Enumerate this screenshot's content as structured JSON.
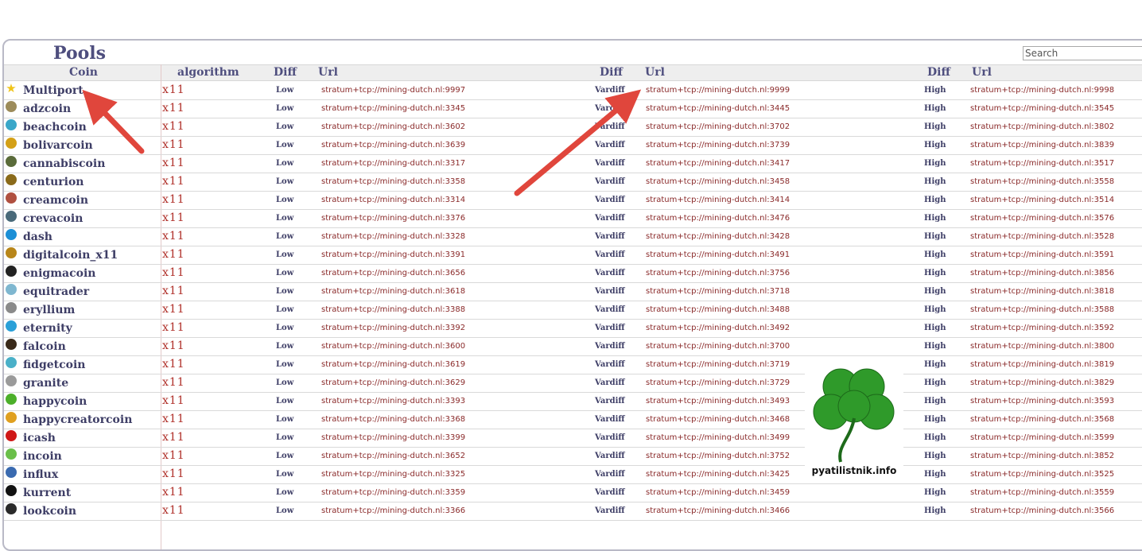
{
  "page": {
    "title": "Pools",
    "search_placeholder": "Search"
  },
  "headers": {
    "coin": "Coin",
    "algorithm": "algorithm",
    "diff1": "Diff",
    "url1": "Url",
    "diff2": "Diff",
    "url2": "Url",
    "diff3": "Diff",
    "url3": "Url"
  },
  "rows": [
    {
      "coin": "Multiport",
      "icon": "star-icon",
      "icon_color": "#f0c419",
      "algo": "x11",
      "d1": "Low",
      "u1": "stratum+tcp://mining-dutch.nl:9997",
      "d2": "Vardiff",
      "u2": "stratum+tcp://mining-dutch.nl:9999",
      "d3": "High",
      "u3": "stratum+tcp://mining-dutch.nl:9998"
    },
    {
      "coin": "adzcoin",
      "icon": "coin-icon",
      "icon_color": "#9c8b5a",
      "algo": "x11",
      "d1": "Low",
      "u1": "stratum+tcp://mining-dutch.nl:3345",
      "d2": "Vardiff",
      "u2": "stratum+tcp://mining-dutch.nl:3445",
      "d3": "High",
      "u3": "stratum+tcp://mining-dutch.nl:3545"
    },
    {
      "coin": "beachcoin",
      "icon": "coin-icon",
      "icon_color": "#3aa7c9",
      "algo": "x11",
      "d1": "Low",
      "u1": "stratum+tcp://mining-dutch.nl:3602",
      "d2": "Vardiff",
      "u2": "stratum+tcp://mining-dutch.nl:3702",
      "d3": "High",
      "u3": "stratum+tcp://mining-dutch.nl:3802"
    },
    {
      "coin": "bolivarcoin",
      "icon": "coin-icon",
      "icon_color": "#d4a017",
      "algo": "x11",
      "d1": "Low",
      "u1": "stratum+tcp://mining-dutch.nl:3639",
      "d2": "Vardiff",
      "u2": "stratum+tcp://mining-dutch.nl:3739",
      "d3": "High",
      "u3": "stratum+tcp://mining-dutch.nl:3839"
    },
    {
      "coin": "cannabiscoin",
      "icon": "coin-icon",
      "icon_color": "#5a6b3a",
      "algo": "x11",
      "d1": "Low",
      "u1": "stratum+tcp://mining-dutch.nl:3317",
      "d2": "Vardiff",
      "u2": "stratum+tcp://mining-dutch.nl:3417",
      "d3": "High",
      "u3": "stratum+tcp://mining-dutch.nl:3517"
    },
    {
      "coin": "centurion",
      "icon": "coin-icon",
      "icon_color": "#8a6a1a",
      "algo": "x11",
      "d1": "Low",
      "u1": "stratum+tcp://mining-dutch.nl:3358",
      "d2": "Vardiff",
      "u2": "stratum+tcp://mining-dutch.nl:3458",
      "d3": "High",
      "u3": "stratum+tcp://mining-dutch.nl:3558"
    },
    {
      "coin": "creamcoin",
      "icon": "coin-icon",
      "icon_color": "#b05040",
      "algo": "x11",
      "d1": "Low",
      "u1": "stratum+tcp://mining-dutch.nl:3314",
      "d2": "Vardiff",
      "u2": "stratum+tcp://mining-dutch.nl:3414",
      "d3": "High",
      "u3": "stratum+tcp://mining-dutch.nl:3514"
    },
    {
      "coin": "crevacoin",
      "icon": "coin-icon",
      "icon_color": "#4a6a7a",
      "algo": "x11",
      "d1": "Low",
      "u1": "stratum+tcp://mining-dutch.nl:3376",
      "d2": "Vardiff",
      "u2": "stratum+tcp://mining-dutch.nl:3476",
      "d3": "High",
      "u3": "stratum+tcp://mining-dutch.nl:3576"
    },
    {
      "coin": "dash",
      "icon": "coin-icon",
      "icon_color": "#1c8fd6",
      "algo": "x11",
      "d1": "Low",
      "u1": "stratum+tcp://mining-dutch.nl:3328",
      "d2": "Vardiff",
      "u2": "stratum+tcp://mining-dutch.nl:3428",
      "d3": "High",
      "u3": "stratum+tcp://mining-dutch.nl:3528"
    },
    {
      "coin": "digitalcoin_x11",
      "icon": "coin-icon",
      "icon_color": "#b8861a",
      "algo": "x11",
      "d1": "Low",
      "u1": "stratum+tcp://mining-dutch.nl:3391",
      "d2": "Vardiff",
      "u2": "stratum+tcp://mining-dutch.nl:3491",
      "d3": "High",
      "u3": "stratum+tcp://mining-dutch.nl:3591"
    },
    {
      "coin": "enigmacoin",
      "icon": "coin-icon",
      "icon_color": "#222222",
      "algo": "x11",
      "d1": "Low",
      "u1": "stratum+tcp://mining-dutch.nl:3656",
      "d2": "Vardiff",
      "u2": "stratum+tcp://mining-dutch.nl:3756",
      "d3": "High",
      "u3": "stratum+tcp://mining-dutch.nl:3856"
    },
    {
      "coin": "equitrader",
      "icon": "coin-icon",
      "icon_color": "#7fb7d0",
      "algo": "x11",
      "d1": "Low",
      "u1": "stratum+tcp://mining-dutch.nl:3618",
      "d2": "Vardiff",
      "u2": "stratum+tcp://mining-dutch.nl:3718",
      "d3": "High",
      "u3": "stratum+tcp://mining-dutch.nl:3818"
    },
    {
      "coin": "eryllium",
      "icon": "coin-icon",
      "icon_color": "#8a8a8a",
      "algo": "x11",
      "d1": "Low",
      "u1": "stratum+tcp://mining-dutch.nl:3388",
      "d2": "Vardiff",
      "u2": "stratum+tcp://mining-dutch.nl:3488",
      "d3": "High",
      "u3": "stratum+tcp://mining-dutch.nl:3588"
    },
    {
      "coin": "eternity",
      "icon": "coin-icon",
      "icon_color": "#2aa0d8",
      "algo": "x11",
      "d1": "Low",
      "u1": "stratum+tcp://mining-dutch.nl:3392",
      "d2": "Vardiff",
      "u2": "stratum+tcp://mining-dutch.nl:3492",
      "d3": "High",
      "u3": "stratum+tcp://mining-dutch.nl:3592"
    },
    {
      "coin": "falcoin",
      "icon": "coin-icon",
      "icon_color": "#3a2a1a",
      "algo": "x11",
      "d1": "Low",
      "u1": "stratum+tcp://mining-dutch.nl:3600",
      "d2": "Vardiff",
      "u2": "stratum+tcp://mining-dutch.nl:3700",
      "d3": "High",
      "u3": "stratum+tcp://mining-dutch.nl:3800"
    },
    {
      "coin": "fidgetcoin",
      "icon": "coin-icon",
      "icon_color": "#4ab0c8",
      "algo": "x11",
      "d1": "Low",
      "u1": "stratum+tcp://mining-dutch.nl:3619",
      "d2": "Vardiff",
      "u2": "stratum+tcp://mining-dutch.nl:3719",
      "d3": "High",
      "u3": "stratum+tcp://mining-dutch.nl:3819"
    },
    {
      "coin": "granite",
      "icon": "coin-icon",
      "icon_color": "#9a9a9a",
      "algo": "x11",
      "d1": "Low",
      "u1": "stratum+tcp://mining-dutch.nl:3629",
      "d2": "Vardiff",
      "u2": "stratum+tcp://mining-dutch.nl:3729",
      "d3": "High",
      "u3": "stratum+tcp://mining-dutch.nl:3829"
    },
    {
      "coin": "happycoin",
      "icon": "coin-icon",
      "icon_color": "#4caf2a",
      "algo": "x11",
      "d1": "Low",
      "u1": "stratum+tcp://mining-dutch.nl:3393",
      "d2": "Vardiff",
      "u2": "stratum+tcp://mining-dutch.nl:3493",
      "d3": "High",
      "u3": "stratum+tcp://mining-dutch.nl:3593"
    },
    {
      "coin": "happycreatorcoin",
      "icon": "coin-icon",
      "icon_color": "#e0a020",
      "algo": "x11",
      "d1": "Low",
      "u1": "stratum+tcp://mining-dutch.nl:3368",
      "d2": "Vardiff",
      "u2": "stratum+tcp://mining-dutch.nl:3468",
      "d3": "High",
      "u3": "stratum+tcp://mining-dutch.nl:3568"
    },
    {
      "coin": "icash",
      "icon": "coin-icon",
      "icon_color": "#d01818",
      "algo": "x11",
      "d1": "Low",
      "u1": "stratum+tcp://mining-dutch.nl:3399",
      "d2": "Vardiff",
      "u2": "stratum+tcp://mining-dutch.nl:3499",
      "d3": "High",
      "u3": "stratum+tcp://mining-dutch.nl:3599"
    },
    {
      "coin": "incoin",
      "icon": "coin-icon",
      "icon_color": "#6abf4a",
      "algo": "x11",
      "d1": "Low",
      "u1": "stratum+tcp://mining-dutch.nl:3652",
      "d2": "Vardiff",
      "u2": "stratum+tcp://mining-dutch.nl:3752",
      "d3": "High",
      "u3": "stratum+tcp://mining-dutch.nl:3852"
    },
    {
      "coin": "influx",
      "icon": "coin-icon",
      "icon_color": "#3a6ab0",
      "algo": "x11",
      "d1": "Low",
      "u1": "stratum+tcp://mining-dutch.nl:3325",
      "d2": "Vardiff",
      "u2": "stratum+tcp://mining-dutch.nl:3425",
      "d3": "High",
      "u3": "stratum+tcp://mining-dutch.nl:3525"
    },
    {
      "coin": "kurrent",
      "icon": "coin-icon",
      "icon_color": "#111111",
      "algo": "x11",
      "d1": "Low",
      "u1": "stratum+tcp://mining-dutch.nl:3359",
      "d2": "Vardiff",
      "u2": "stratum+tcp://mining-dutch.nl:3459",
      "d3": "High",
      "u3": "stratum+tcp://mining-dutch.nl:3559"
    },
    {
      "coin": "lookcoin",
      "icon": "coin-icon",
      "icon_color": "#2a2a2a",
      "algo": "x11",
      "d1": "Low",
      "u1": "stratum+tcp://mining-dutch.nl:3366",
      "d2": "Vardiff",
      "u2": "stratum+tcp://mining-dutch.nl:3466",
      "d3": "High",
      "u3": "stratum+tcp://mining-dutch.nl:3566"
    }
  ],
  "watermark": {
    "text": "pyatilistnik.info",
    "icon": "clover-icon"
  },
  "colors": {
    "title": "#4e4e7e",
    "algo": "#b0302a",
    "url": "#8a2a2a",
    "arrow": "#e0463c"
  }
}
